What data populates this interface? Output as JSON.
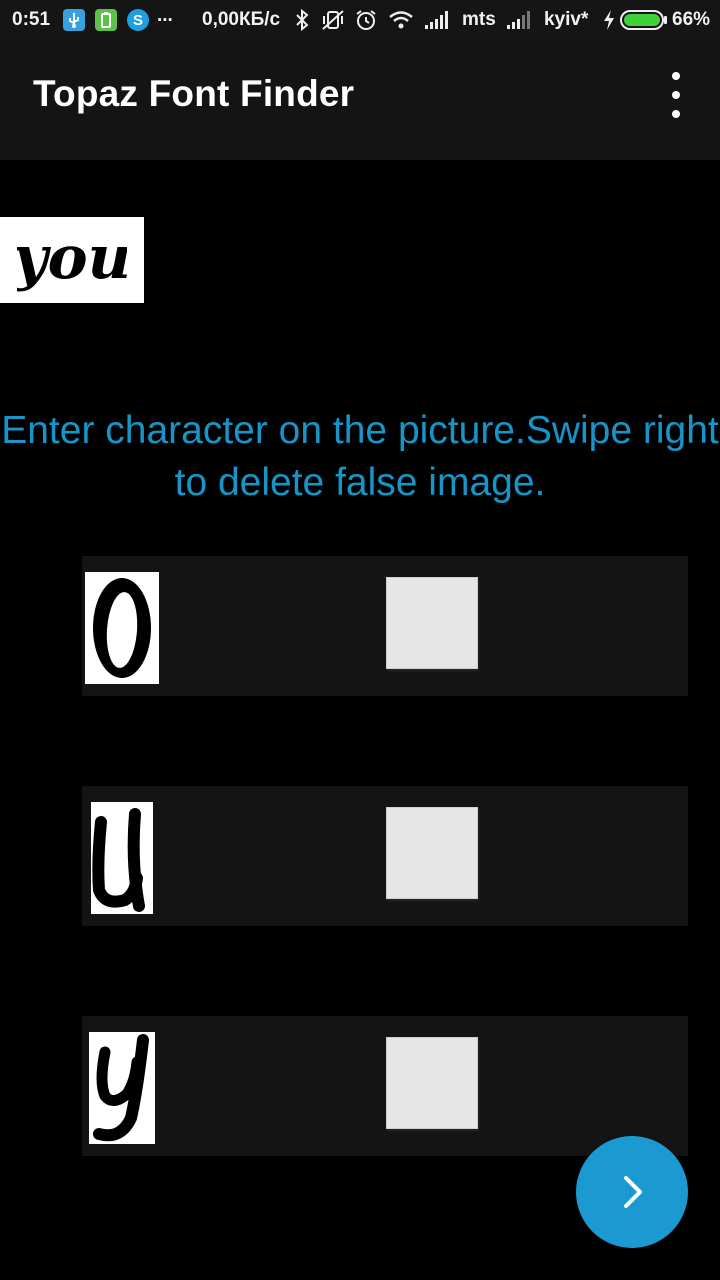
{
  "status_bar": {
    "time": "0:51",
    "more_dots": "...",
    "speed": "0,00КБ/с",
    "carrier1": "mts",
    "carrier2": "kyiv*",
    "battery": "66%",
    "icons": [
      "usb-icon",
      "battery-saver-icon",
      "skype-icon",
      "bluetooth-icon",
      "vibrate-off-icon",
      "alarm-icon",
      "wifi-icon",
      "signal-icon",
      "charging-icon"
    ]
  },
  "app_bar": {
    "title": "Topaz Font Finder",
    "menu_icon": "more-vert-icon"
  },
  "source_preview": {
    "text": "you"
  },
  "instructions": "Enter character on the picture.Swipe right to delete false image.",
  "rows": [
    {
      "glyph": "O",
      "input_value": ""
    },
    {
      "glyph": "u",
      "input_value": ""
    },
    {
      "glyph": "y",
      "input_value": ""
    }
  ],
  "next_button": {
    "icon": "chevron-right-icon"
  },
  "colors": {
    "accent": "#1a9ad0",
    "instruction_text": "#1595c8",
    "row_background": "#141414",
    "background": "#000000"
  }
}
